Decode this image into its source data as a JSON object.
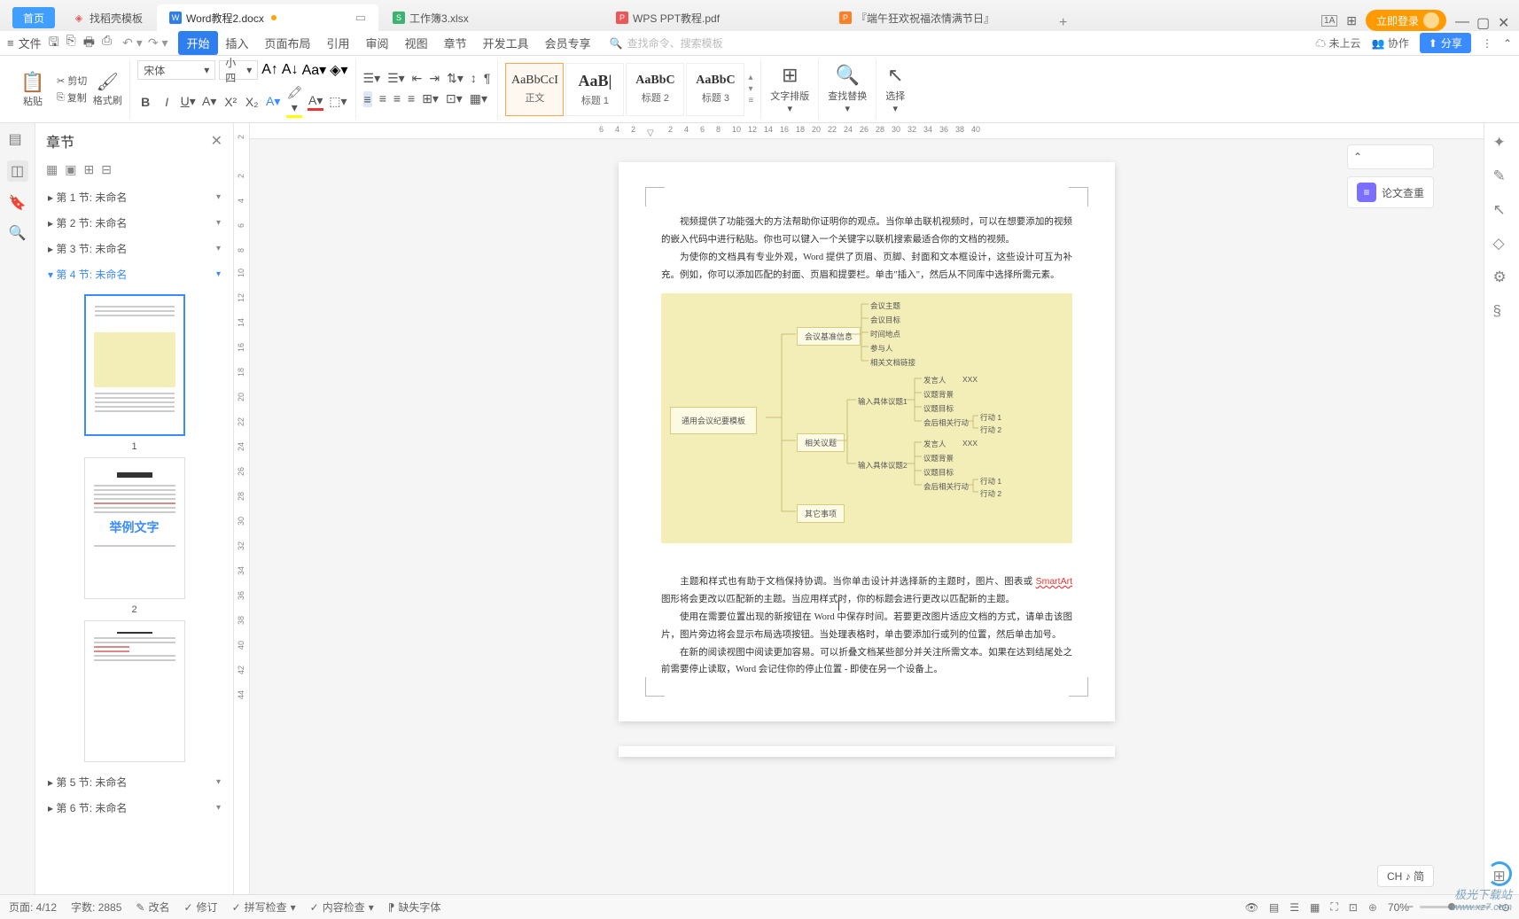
{
  "titlebar": {
    "home": "首页",
    "tabs": [
      {
        "icon_color": "#e55",
        "label": "找稻壳模板"
      },
      {
        "icon_color": "#2e7eee",
        "label": "Word教程2.docx",
        "active": true
      },
      {
        "icon_color": "#3cb371",
        "label": "工作簿3.xlsx"
      },
      {
        "icon_color": "#e55",
        "label": "WPS PPT教程.pdf"
      },
      {
        "icon_color": "#ff7f27",
        "label": "『端午狂欢祝福浓情满节日』"
      }
    ],
    "login": "立即登录"
  },
  "menubar": {
    "file": "文件",
    "items": [
      "开始",
      "插入",
      "页面布局",
      "引用",
      "审阅",
      "视图",
      "章节",
      "开发工具",
      "会员专享"
    ],
    "active_index": 0,
    "search_placeholder": "查找命令、搜索模板",
    "cloud": "未上云",
    "collab": "协作",
    "share": "分享"
  },
  "ribbon": {
    "clipboard": {
      "paste": "粘贴",
      "cut": "剪切",
      "copy": "复制",
      "brush": "格式刷"
    },
    "font": {
      "name": "宋体",
      "size": "小四"
    },
    "styles": [
      {
        "preview": "AaBbCcI",
        "name": "正文"
      },
      {
        "preview": "AaB|",
        "name": "标题 1"
      },
      {
        "preview": "AaBbC",
        "name": "标题 2"
      },
      {
        "preview": "AaBbC",
        "name": "标题 3"
      }
    ],
    "tool_layout": "文字排版",
    "tool_find": "查找替换",
    "tool_select": "选择"
  },
  "chapter": {
    "title": "章节",
    "sections": [
      "第 1 节: 未命名",
      "第 2 节: 未命名",
      "第 3 节: 未命名",
      "第 4 节: 未命名",
      "第 5 节: 未命名",
      "第 6 节: 未命名"
    ],
    "expanded": 3,
    "thumb2_big": "举例文字"
  },
  "hruler": [
    6,
    4,
    2,
    2,
    4,
    6,
    8,
    10,
    12,
    14,
    16,
    18,
    20,
    22,
    24,
    26,
    28,
    30,
    32,
    34,
    36,
    38,
    40
  ],
  "vruler": [
    2,
    2,
    4,
    6,
    8,
    10,
    12,
    14,
    16,
    18,
    20,
    22,
    24,
    26,
    28,
    30,
    32,
    34,
    36,
    38,
    40,
    42,
    44
  ],
  "document": {
    "p1": "视频提供了功能强大的方法帮助你证明你的观点。当你单击联机视频时，可以在想要添加的视频的嵌入代码中进行粘贴。你也可以键入一个关键字以联机搜索最适合你的文档的视频。",
    "p2": "为使你的文档具有专业外观，Word 提供了页眉、页脚、封面和文本框设计，这些设计可互为补充。例如，你可以添加匹配的封面、页眉和提要栏。单击\"插入\"，然后从不同库中选择所需元素。",
    "p3a": "主题和样式也有助于文档保持协调。当你单击设计并选择新的主题时，图片、图表或 ",
    "p3b": "SmartArt",
    "p3c": " 图形将会更改以匹配新的主题。当应用样式时，你的标题会进行更改以匹配新的主题。",
    "p4": "使用在需要位置出现的新按钮在 Word 中保存时间。若要更改图片适应文档的方式，请单击该图片，图片旁边将会显示布局选项按钮。当处理表格时，单击要添加行或列的位置，然后单击加号。",
    "p5": "在新的阅读视图中阅读更加容易。可以折叠文档某些部分并关注所需文本。如果在达到结尾处之前需要停止读取，Word 会记住你的停止位置 - 即使在另一个设备上。"
  },
  "diagram": {
    "root": "通用会议纪要模板",
    "n_basic": "会议基准信息",
    "n_related": "相关议题",
    "n_other": "其它事项",
    "leaves1": [
      "会议主题",
      "会议目标",
      "时间地点",
      "参与人",
      "相关文档链接"
    ],
    "topic1": "输入具体议题1",
    "topic2": "输入具体议题2",
    "tinfo": [
      "发言人",
      "议题背景",
      "议题目标",
      "会后相关行动"
    ],
    "who": "XXX",
    "action": [
      "行动 1",
      "行动 2"
    ]
  },
  "right": {
    "check": "论文查重"
  },
  "ime": "CH ♪ 简",
  "statusbar": {
    "page": "页面: 4/12",
    "words": "字数: 2885",
    "rename": "改名",
    "revision": "修订",
    "spell": "拼写检查",
    "content": "内容检查",
    "missing_font": "缺失字体",
    "zoom": "70%"
  },
  "watermark": {
    "name": "极光下载站",
    "url": "www.xz7.com"
  }
}
